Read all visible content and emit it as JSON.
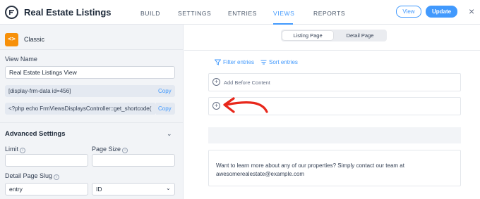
{
  "app": {
    "title": "Real Estate Listings"
  },
  "nav": {
    "items": [
      "BUILD",
      "SETTINGS",
      "ENTRIES",
      "VIEWS",
      "REPORTS"
    ],
    "active": "VIEWS"
  },
  "actions": {
    "view_label": "View",
    "update_label": "Update",
    "close_symbol": "×"
  },
  "sidebar": {
    "view_type": "Classic",
    "view_name_label": "View Name",
    "view_name_value": "Real Estate Listings View",
    "shortcode_1": "[display-frm-data id=456]",
    "shortcode_2": "<?php echo FrmViewsDisplaysController::get_shortcode(",
    "copy_label": "Copy",
    "advanced_title": "Advanced Settings",
    "limit_label": "Limit",
    "limit_value": "",
    "page_size_label": "Page Size",
    "page_size_value": "",
    "slug_label": "Detail Page Slug",
    "slug_value": "entry",
    "slug_type_selected": "ID"
  },
  "main": {
    "tabs": [
      "Listing Page",
      "Detail Page"
    ],
    "active_tab": "Listing Page",
    "filter_label": "Filter entries",
    "sort_label": "Sort entries",
    "before_content_label": "Add Before Content",
    "content_text": "Want to learn more about any of our properties? Simply contact our team at awesomerealestate@example.com"
  },
  "colors": {
    "accent": "#4199fd",
    "classic_icon": "#f79009",
    "annotation_arrow": "#e8271b"
  },
  "icons": {
    "logo": "formidable-logo-icon",
    "classic": "code-brackets-icon",
    "filter": "filter-icon",
    "sort": "sort-icon",
    "add": "plus-circle-icon",
    "chevron": "chevron-down-icon",
    "info": "info-icon"
  }
}
